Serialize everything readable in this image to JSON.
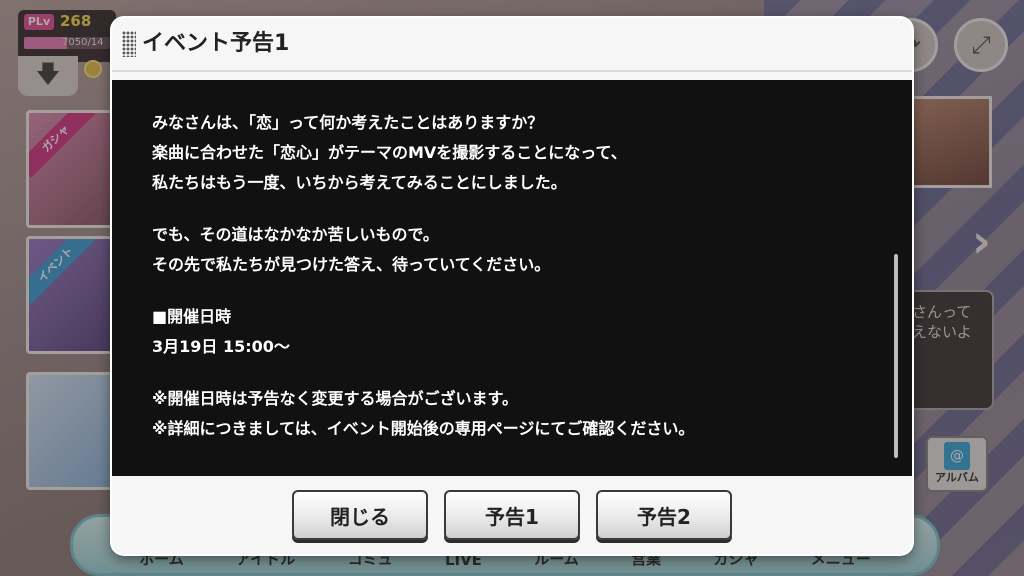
{
  "background": {
    "player_level": {
      "badge": "PLv",
      "value": "268",
      "exp_text": "7050/14",
      "exp_fraction": 0.5
    },
    "side_cards": {
      "gacha_tag": "ガシャ",
      "event_tag": "イベント"
    },
    "speech_bubble": "さんって\nえないよ",
    "album_label": "アルバム",
    "bottom_nav": [
      "ホーム",
      "アイドル",
      "コミュ",
      "LIVE",
      "ルーム",
      "営業",
      "ガシャ",
      "メニュー"
    ]
  },
  "modal": {
    "title": "イベント予告1",
    "body": {
      "paragraph1": [
        "みなさんは、「恋」って何か考えたことはありますか？",
        "楽曲に合わせた「恋心」がテーマのMVを撮影することになって、",
        "私たちはもう一度、いちから考えてみることにしました。"
      ],
      "paragraph2": [
        "でも、その道はなかなか苦しいもので。",
        "その先で私たちが見つけた答え、待っていてください。"
      ],
      "schedule_heading": "■開催日時",
      "schedule_value": "3月19日 15:00〜",
      "notes": [
        "※開催日時は予告なく変更する場合がございます。",
        "※詳細につきましては、イベント開始後の専用ページにてご確認ください。"
      ]
    },
    "buttons": {
      "close_label": "閉じる",
      "preview1_label": "予告1",
      "preview2_label": "予告2"
    }
  }
}
